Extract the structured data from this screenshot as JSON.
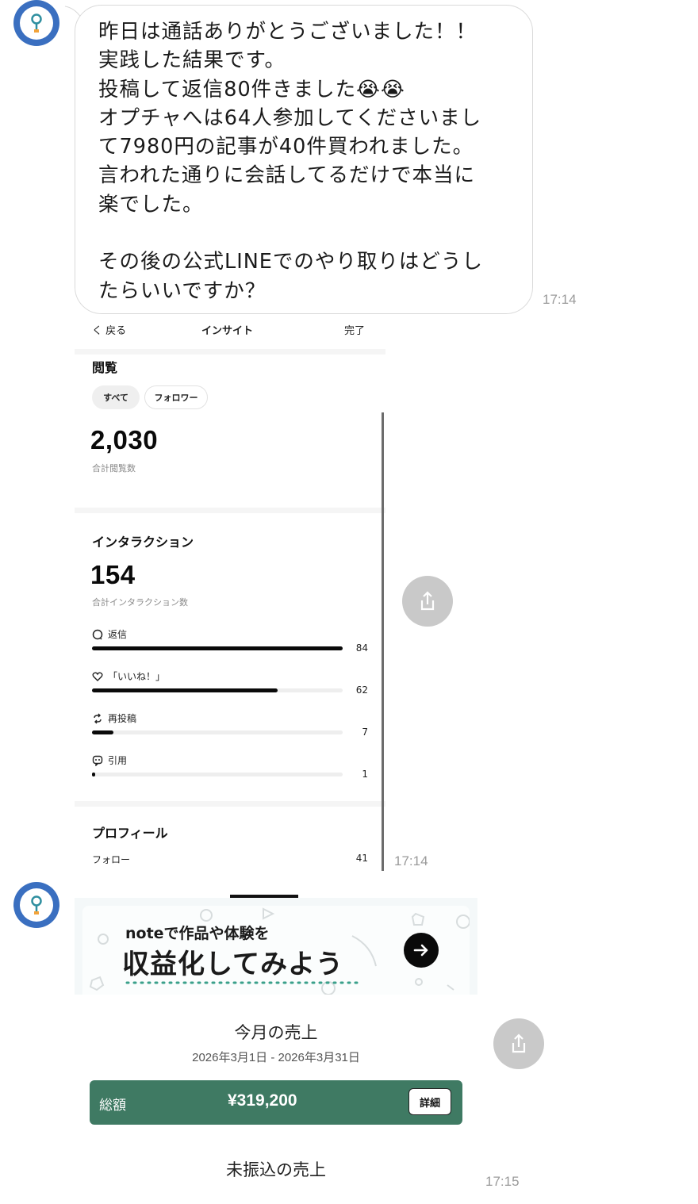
{
  "message1": {
    "lines": [
      "昨日は通話ありがとうございました！！",
      "実践した結果です。",
      "投稿して返信80件きました😭😭",
      "オプチャへは64人参加してくださいまし",
      "て7980円の記事が40件買われました。",
      "言われた通りに会話してるだけで本当に",
      "楽でした。",
      "",
      "その後の公式LINEでのやり取りはどうし",
      "たらいいですか？"
    ],
    "time": "17:14"
  },
  "insight": {
    "nav": {
      "back": "く 戻る",
      "title": "インサイト",
      "done": "完了"
    },
    "views": {
      "heading": "閲覧",
      "filters": [
        "すべて",
        "フォロワー"
      ],
      "total": "2,030",
      "total_label": "合計閲覧数"
    },
    "interactions": {
      "heading": "インタラクション",
      "total": "154",
      "total_label": "合計インタラクション数",
      "metrics": [
        {
          "icon": "reply-icon",
          "label": "返信",
          "value": "84",
          "fraction": 1.0
        },
        {
          "icon": "heart-icon",
          "label": "「いいね！」",
          "value": "62",
          "fraction": 0.74
        },
        {
          "icon": "repost-icon",
          "label": "再投稿",
          "value": "7",
          "fraction": 0.085
        },
        {
          "icon": "quote-icon",
          "label": "引用",
          "value": "1",
          "fraction": 0.012
        }
      ]
    },
    "profile": {
      "heading": "プロフィール",
      "follow_label": "フォロー",
      "follow_value": "41"
    },
    "time": "17:14"
  },
  "note": {
    "banner_small": "noteで作品や体験を",
    "banner_big": "収益化してみよう",
    "sales_title": "今月の売上",
    "period": "2026年3月1日 - 2026年3月31日",
    "total_label": "総額",
    "total_value": "¥319,200",
    "detail_button": "詳細",
    "unpaid_title": "未振込の売上",
    "time": "17:15",
    "accent_color": "#3f7a63"
  }
}
